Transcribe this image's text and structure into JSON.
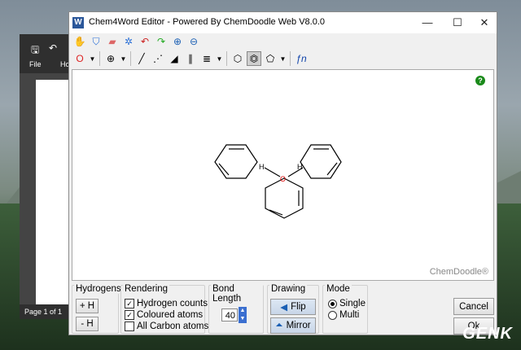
{
  "word": {
    "menu_file": "File",
    "menu_home_partial": "Ho",
    "status": "Page 1 of 1"
  },
  "dialog": {
    "title": "Chem4Word Editor - Powered By ChemDoodle Web V8.0.0",
    "minimize": "—",
    "maximize": "☐",
    "close": "✕",
    "canvas": {
      "help": "?",
      "brand": "ChemDoodle®",
      "atom_o": "O",
      "atom_h1": "H",
      "atom_h2": "H"
    },
    "groups": {
      "hydrogens": {
        "title": "Hydrogens",
        "add": "+ H",
        "remove": "- H"
      },
      "rendering": {
        "title": "Rendering",
        "hydrogen_counts": "Hydrogen counts",
        "coloured_atoms": "Coloured atoms",
        "all_carbon": "All Carbon atoms"
      },
      "bond_length": {
        "title": "Bond Length",
        "value": "40"
      },
      "drawing": {
        "title": "Drawing",
        "flip": "Flip",
        "mirror": "Mirror"
      },
      "mode": {
        "title": "Mode",
        "single": "Single",
        "multi": "Multi"
      }
    },
    "cancel": "Cancel",
    "ok": "Ok"
  },
  "watermark": "GENK"
}
